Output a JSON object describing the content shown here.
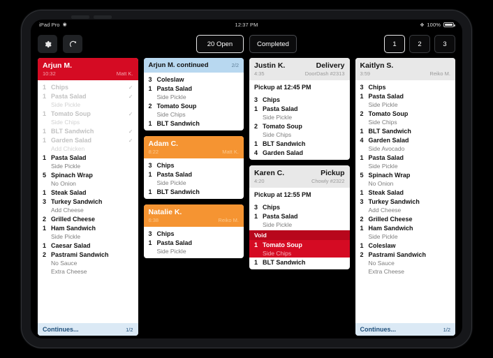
{
  "status_bar": {
    "device": "iPad Pro",
    "wifi_icon": "wifi-icon",
    "time": "12:37 PM",
    "bluetooth_icon": "bluetooth-icon",
    "battery_percent": "100%"
  },
  "toolbar": {
    "settings_icon": "gear-icon",
    "refresh_icon": "refresh-icon",
    "segments": [
      {
        "label": "20 Open",
        "selected": true
      },
      {
        "label": "Completed",
        "selected": false
      }
    ],
    "pages": [
      {
        "label": "1",
        "selected": true
      },
      {
        "label": "2",
        "selected": false
      },
      {
        "label": "3",
        "selected": false
      }
    ]
  },
  "colors": {
    "urgent_red": "#d50b23",
    "warning_orange": "#f59432",
    "normal_grey": "#e8e8e8",
    "continued_blue": "#b8d8f0",
    "footer_blue": "#dbe9f5",
    "void_red": "#b8071c"
  },
  "columns": [
    {
      "tickets": [
        {
          "header_style": "red",
          "name": "Arjun M.",
          "time": "10:32",
          "server": "Matt K.",
          "items": [
            {
              "qty": "1",
              "name": "Chips",
              "done": true,
              "check": true,
              "mods": []
            },
            {
              "qty": "1",
              "name": "Pasta Salad",
              "done": true,
              "check": true,
              "mods": [
                "Side Pickle"
              ]
            },
            {
              "qty": "1",
              "name": "Tomato Soup",
              "done": true,
              "check": true,
              "mods": [
                "Side Chips"
              ]
            },
            {
              "qty": "1",
              "name": "BLT Sandwich",
              "done": true,
              "check": true,
              "mods": []
            },
            {
              "qty": "1",
              "name": "Garden Salad",
              "done": true,
              "check": true,
              "mods": [
                "Add Chicken"
              ]
            },
            {
              "qty": "1",
              "name": "Pasta Salad",
              "done": false,
              "check": false,
              "mods": [
                "Side Pickle"
              ]
            },
            {
              "qty": "5",
              "name": "Spinach Wrap",
              "done": false,
              "check": false,
              "mods": [
                "No Onion"
              ]
            },
            {
              "qty": "1",
              "name": "Steak Salad",
              "done": false,
              "check": false,
              "mods": []
            },
            {
              "qty": "3",
              "name": "Turkey Sandwich",
              "done": false,
              "check": false,
              "mods": [
                "Add Cheese"
              ]
            },
            {
              "qty": "2",
              "name": "Grilled Cheese",
              "done": false,
              "check": false,
              "mods": []
            },
            {
              "qty": "1",
              "name": "Ham Sandwich",
              "done": false,
              "check": false,
              "mods": [
                "Side Pickle"
              ]
            },
            {
              "qty": "1",
              "name": "Caesar Salad",
              "done": false,
              "check": false,
              "mods": []
            },
            {
              "qty": "2",
              "name": "Pastrami Sandwich",
              "done": false,
              "check": false,
              "mods": [
                "No Sauce",
                "Extra Cheese"
              ]
            }
          ],
          "footer": {
            "label": "Continues...",
            "fraction": "1/2"
          }
        }
      ]
    },
    {
      "tickets": [
        {
          "header_style": "blue",
          "continued_label": "Arjun M. continued",
          "fraction": "2/2",
          "items": [
            {
              "qty": "3",
              "name": "Coleslaw",
              "done": false,
              "check": false,
              "mods": []
            },
            {
              "qty": "1",
              "name": "Pasta Salad",
              "done": false,
              "check": false,
              "mods": [
                "Side Pickle"
              ]
            },
            {
              "qty": "2",
              "name": "Tomato Soup",
              "done": false,
              "check": false,
              "mods": [
                "Side Chips"
              ]
            },
            {
              "qty": "1",
              "name": "BLT Sandwich",
              "done": false,
              "check": false,
              "mods": []
            }
          ]
        },
        {
          "header_style": "orange",
          "name": "Adam C.",
          "time": "8:22",
          "server": "Matt K.",
          "items": [
            {
              "qty": "3",
              "name": "Chips",
              "done": false,
              "check": false,
              "mods": []
            },
            {
              "qty": "1",
              "name": "Pasta Salad",
              "done": false,
              "check": false,
              "mods": [
                "Side Pickle"
              ]
            },
            {
              "qty": "1",
              "name": "BLT Sandwich",
              "done": false,
              "check": false,
              "mods": []
            }
          ]
        },
        {
          "header_style": "orange",
          "name": "Natalie K.",
          "time": "6:38",
          "server": "Reiko M.",
          "items": [
            {
              "qty": "3",
              "name": "Chips",
              "done": false,
              "check": false,
              "mods": []
            },
            {
              "qty": "1",
              "name": "Pasta Salad",
              "done": false,
              "check": false,
              "mods": [
                "Side Pickle"
              ]
            }
          ]
        }
      ]
    },
    {
      "tickets": [
        {
          "header_style": "grey",
          "name": "Justin K.",
          "order_type": "Delivery",
          "time": "4:35",
          "server": "DoorDash #2313",
          "pickup_line": "Pickup at 12:45 PM",
          "items": [
            {
              "qty": "3",
              "name": "Chips",
              "done": false,
              "check": false,
              "mods": []
            },
            {
              "qty": "1",
              "name": "Pasta Salad",
              "done": false,
              "check": false,
              "mods": [
                "Side Pickle"
              ]
            },
            {
              "qty": "2",
              "name": "Tomato Soup",
              "done": false,
              "check": false,
              "mods": [
                "Side Chips"
              ]
            },
            {
              "qty": "1",
              "name": "BLT Sandwich",
              "done": false,
              "check": false,
              "mods": []
            },
            {
              "qty": "4",
              "name": "Garden Salad",
              "done": false,
              "check": false,
              "mods": []
            }
          ]
        },
        {
          "header_style": "grey",
          "name": "Karen C.",
          "order_type": "Pickup",
          "time": "4:20",
          "server": "Chowly #2322",
          "pickup_line": "Pickup at 12:55 PM",
          "items": [
            {
              "qty": "3",
              "name": "Chips",
              "done": false,
              "check": false,
              "mods": []
            },
            {
              "qty": "1",
              "name": "Pasta Salad",
              "done": false,
              "check": false,
              "mods": [
                "Side Pickle"
              ]
            }
          ],
          "void": {
            "label": "Void",
            "items": [
              {
                "qty": "1",
                "name": "Tomato Soup",
                "mods": [
                  "Side Chips"
                ]
              }
            ]
          },
          "items_after_void": [
            {
              "qty": "1",
              "name": "BLT Sandwich",
              "done": false,
              "check": false,
              "mods": []
            }
          ]
        }
      ]
    },
    {
      "tickets": [
        {
          "header_style": "grey",
          "name": "Kaitlyn S.",
          "time": "3:59",
          "server": "Reiko M.",
          "items": [
            {
              "qty": "3",
              "name": "Chips",
              "done": false,
              "check": false,
              "mods": []
            },
            {
              "qty": "1",
              "name": "Pasta Salad",
              "done": false,
              "check": false,
              "mods": [
                "Side Pickle"
              ]
            },
            {
              "qty": "2",
              "name": "Tomato Soup",
              "done": false,
              "check": false,
              "mods": [
                "Side Chips"
              ]
            },
            {
              "qty": "1",
              "name": "BLT Sandwich",
              "done": false,
              "check": false,
              "mods": []
            },
            {
              "qty": "4",
              "name": "Garden Salad",
              "done": false,
              "check": false,
              "mods": [
                "Side Avocado"
              ]
            },
            {
              "qty": "1",
              "name": "Pasta Salad",
              "done": false,
              "check": false,
              "mods": [
                "Side Pickle"
              ]
            },
            {
              "qty": "5",
              "name": "Spinach Wrap",
              "done": false,
              "check": false,
              "mods": [
                "No Onion"
              ]
            },
            {
              "qty": "1",
              "name": "Steak Salad",
              "done": false,
              "check": false,
              "mods": []
            },
            {
              "qty": "3",
              "name": "Turkey Sandwich",
              "done": false,
              "check": false,
              "mods": [
                "Add Cheese"
              ]
            },
            {
              "qty": "2",
              "name": "Grilled Cheese",
              "done": false,
              "check": false,
              "mods": []
            },
            {
              "qty": "1",
              "name": "Ham Sandwich",
              "done": false,
              "check": false,
              "mods": [
                "Side Pickle"
              ]
            },
            {
              "qty": "1",
              "name": "Coleslaw",
              "done": false,
              "check": false,
              "mods": []
            },
            {
              "qty": "2",
              "name": "Pastrami Sandwich",
              "done": false,
              "check": false,
              "mods": [
                "No Sauce",
                "Extra Cheese"
              ]
            }
          ],
          "footer": {
            "label": "Continues...",
            "fraction": "1/2"
          }
        }
      ]
    }
  ]
}
